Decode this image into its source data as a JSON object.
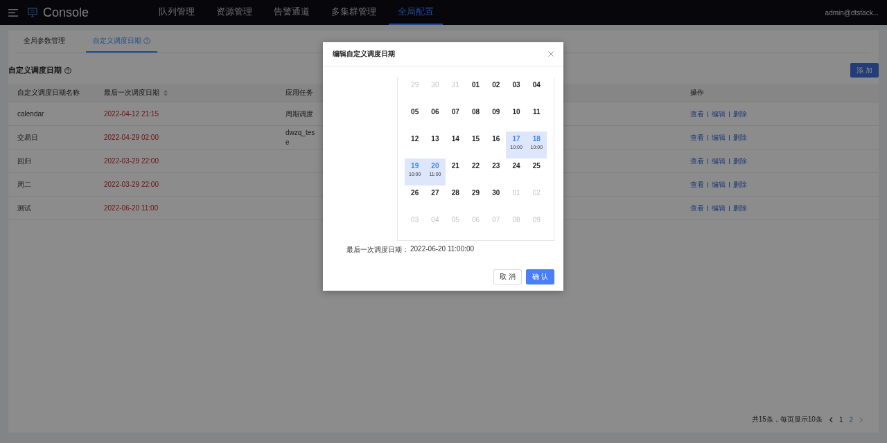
{
  "header": {
    "app_name": "Console",
    "nav": [
      {
        "label": "队列管理",
        "selected": false
      },
      {
        "label": "资源管理",
        "selected": false
      },
      {
        "label": "告警通道",
        "selected": false
      },
      {
        "label": "多集群管理",
        "selected": false
      },
      {
        "label": "全局配置",
        "selected": true
      }
    ],
    "user": "admin@dtstack..."
  },
  "tabs": [
    {
      "label": "全局参数管理",
      "selected": false,
      "help": false
    },
    {
      "label": "自定义调度日期",
      "selected": true,
      "help": true
    }
  ],
  "section_title": "自定义调度日期",
  "add_button": "添 加",
  "table": {
    "columns": [
      {
        "label": "自定义调度日期名称",
        "sortable": false
      },
      {
        "label": "最后一次调度日期",
        "sortable": true
      },
      {
        "label": "应用任务",
        "sortable": false
      },
      {
        "label": "操作",
        "sortable": false
      }
    ],
    "rows": [
      {
        "name": "calendar",
        "last_date": "2022-04-12 21:15",
        "task": "周期调度",
        "actions": [
          "查看",
          "编辑",
          "删除"
        ]
      },
      {
        "name": "交易日",
        "last_date": "2022-04-29 02:00",
        "task": "dwzq_tes\ne",
        "actions": [
          "查看",
          "编辑",
          "删除"
        ]
      },
      {
        "name": "回归",
        "last_date": "2022-03-29 22:00",
        "actions": [
          "查看",
          "编辑",
          "删除"
        ]
      },
      {
        "name": "周二",
        "last_date": "2022-03-29 22:00",
        "actions": [
          "查看",
          "编辑",
          "删除"
        ]
      },
      {
        "name": "测试",
        "last_date": "2022-06-20 11:00",
        "actions": [
          "查看",
          "编辑",
          "删除"
        ]
      }
    ]
  },
  "pagination": {
    "summary": "共15条，每页显示10条",
    "pages": [
      {
        "label": "1",
        "selected": false
      },
      {
        "label": "2",
        "selected": true
      }
    ],
    "next_disabled": true
  },
  "modal": {
    "title": "编辑自定义调度日期",
    "calendar": [
      [
        {
          "day": "29",
          "muted": true,
          "selected": false
        },
        {
          "day": "30",
          "muted": true,
          "selected": false
        },
        {
          "day": "31",
          "muted": true,
          "selected": false
        },
        {
          "day": "01",
          "muted": false,
          "selected": false
        },
        {
          "day": "02",
          "muted": false,
          "selected": false
        },
        {
          "day": "03",
          "muted": false,
          "selected": false
        },
        {
          "day": "04",
          "muted": false,
          "selected": false
        }
      ],
      [
        {
          "day": "05",
          "muted": false,
          "selected": false
        },
        {
          "day": "06",
          "muted": false,
          "selected": false
        },
        {
          "day": "07",
          "muted": false,
          "selected": false
        },
        {
          "day": "08",
          "muted": false,
          "selected": false
        },
        {
          "day": "09",
          "muted": false,
          "selected": false
        },
        {
          "day": "10",
          "muted": false,
          "selected": false
        },
        {
          "day": "11",
          "muted": false,
          "selected": false
        }
      ],
      [
        {
          "day": "12",
          "muted": false,
          "selected": false
        },
        {
          "day": "13",
          "muted": false,
          "selected": false
        },
        {
          "day": "14",
          "muted": false,
          "selected": false
        },
        {
          "day": "15",
          "muted": false,
          "selected": false
        },
        {
          "day": "16",
          "muted": false,
          "selected": false
        },
        {
          "day": "17",
          "muted": false,
          "selected": true,
          "time": "10:00"
        },
        {
          "day": "18",
          "muted": false,
          "selected": true,
          "time": "10:00"
        }
      ],
      [
        {
          "day": "19",
          "muted": false,
          "selected": true,
          "time": "10:00"
        },
        {
          "day": "20",
          "muted": false,
          "selected": true,
          "time": "11:00"
        },
        {
          "day": "21",
          "muted": false,
          "selected": false
        },
        {
          "day": "22",
          "muted": false,
          "selected": false
        },
        {
          "day": "23",
          "muted": false,
          "selected": false
        },
        {
          "day": "24",
          "muted": false,
          "selected": false
        },
        {
          "day": "25",
          "muted": false,
          "selected": false
        }
      ],
      [
        {
          "day": "26",
          "muted": false,
          "selected": false
        },
        {
          "day": "27",
          "muted": false,
          "selected": false
        },
        {
          "day": "28",
          "muted": false,
          "selected": false
        },
        {
          "day": "29",
          "muted": false,
          "selected": false
        },
        {
          "day": "30",
          "muted": false,
          "selected": false
        },
        {
          "day": "01",
          "muted": true,
          "selected": false
        },
        {
          "day": "02",
          "muted": true,
          "selected": false
        }
      ],
      [
        {
          "day": "03",
          "muted": true,
          "selected": false
        },
        {
          "day": "04",
          "muted": true,
          "selected": false
        },
        {
          "day": "05",
          "muted": true,
          "selected": false
        },
        {
          "day": "06",
          "muted": true,
          "selected": false
        },
        {
          "day": "07",
          "muted": true,
          "selected": false
        },
        {
          "day": "08",
          "muted": true,
          "selected": false
        },
        {
          "day": "09",
          "muted": true,
          "selected": false
        }
      ]
    ],
    "summary_label": "最后一次调度日期：",
    "summary_value": "2022-06-20 11:00:00",
    "cancel": "取 消",
    "confirm": "确 认"
  }
}
